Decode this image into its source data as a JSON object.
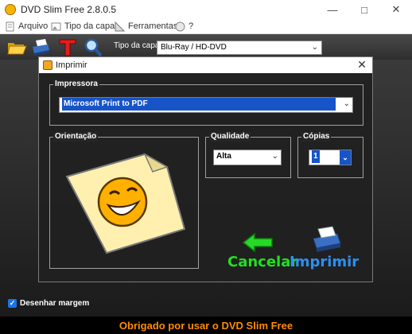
{
  "window": {
    "title": "DVD Slim Free 2.8.0.5"
  },
  "menu": [
    {
      "label": "Arquivo"
    },
    {
      "label": "Tipo da capa"
    },
    {
      "label": "Ferramentas"
    },
    {
      "label": "?"
    }
  ],
  "toolbar": {
    "cover_type_label": "Tipo da capa",
    "cover_type_value": "Blu-Ray / HD-DVD"
  },
  "options": {
    "draw_margin_label": "Desenhar margem",
    "draw_margin_checked": true
  },
  "footer": {
    "text": "Obrigado por usar o DVD Slim Free"
  },
  "dialog": {
    "title": "Imprimir",
    "printer_group": "Impressora",
    "printer_value": "Microsoft Print to PDF",
    "orientation_group": "Orientação",
    "quality_group": "Qualidade",
    "quality_value": "Alta",
    "copies_group": "Cópias",
    "copies_value": "1",
    "cancel_label": "Cancelar",
    "print_label": "Imprimir"
  },
  "colors": {
    "footer_text": "#ff8c00",
    "cancel": "#20e020",
    "print": "#2d8ff0",
    "selection": "#1654c8"
  }
}
